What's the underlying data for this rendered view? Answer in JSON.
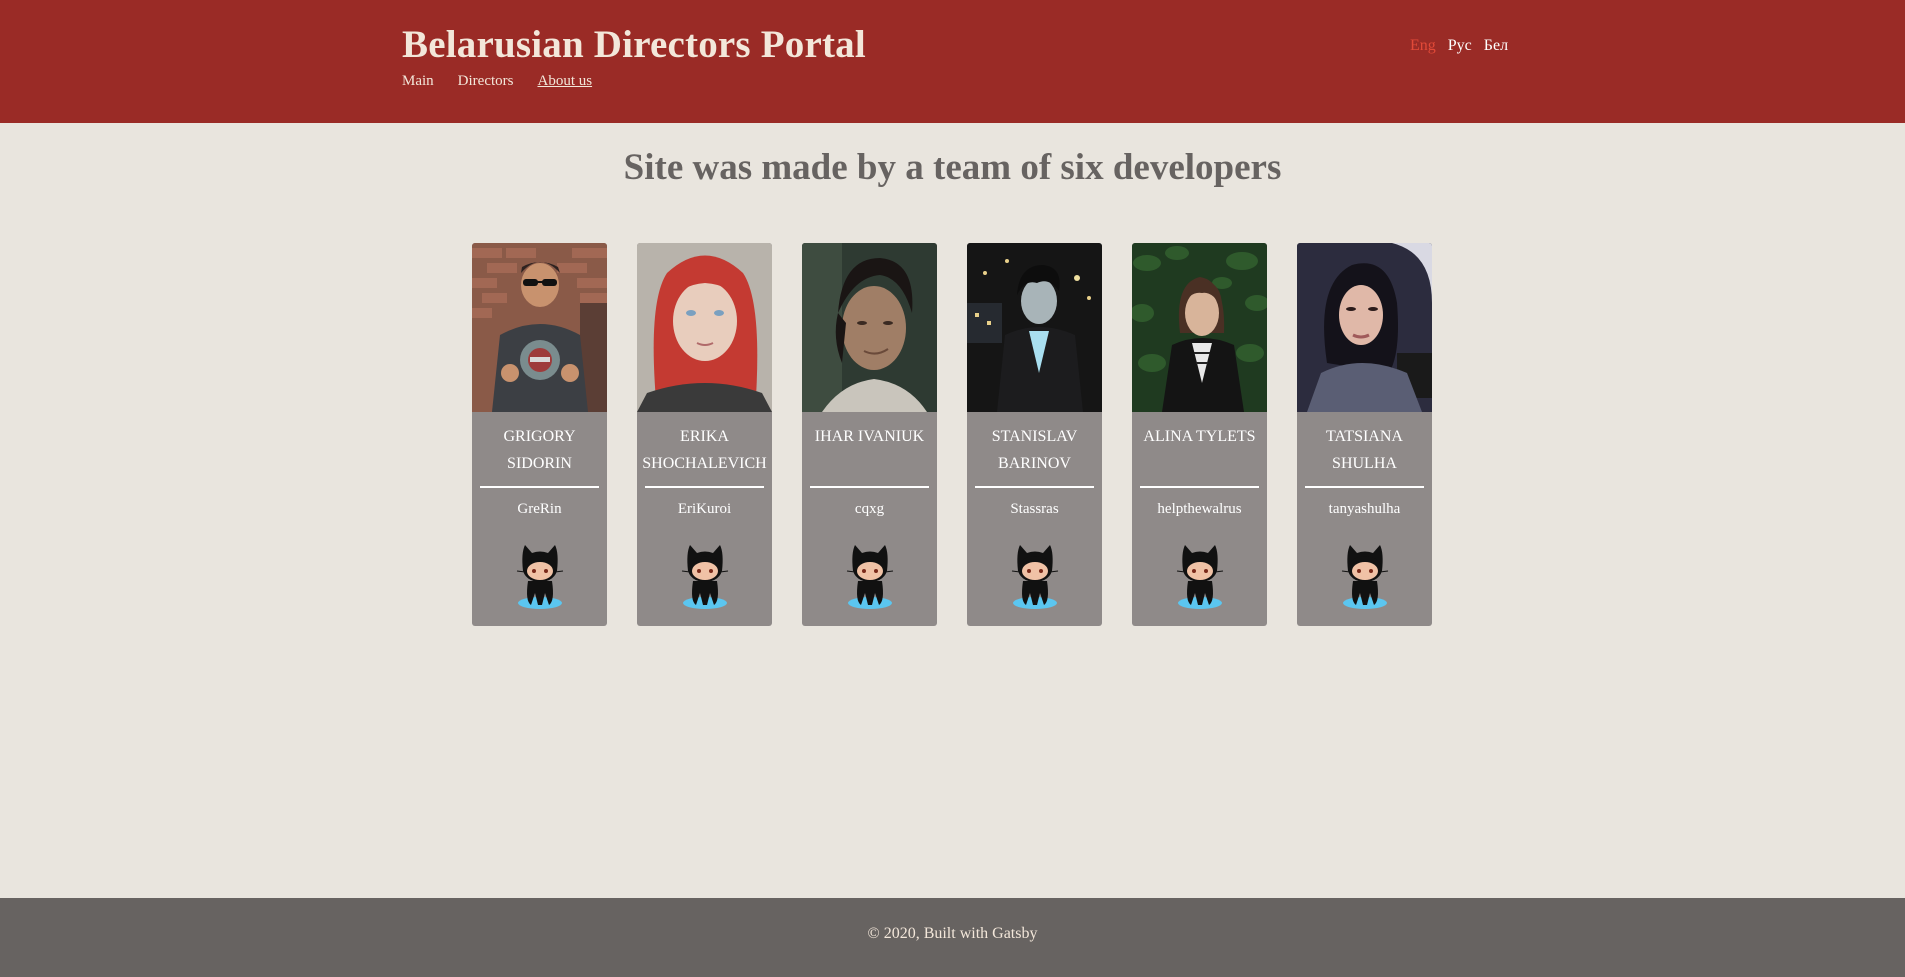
{
  "header": {
    "title": "Belarusian Directors Portal",
    "nav": [
      "Main",
      "Directors",
      "About us"
    ],
    "active_nav": "About us",
    "languages": [
      "Eng",
      "Рус",
      "Бел"
    ],
    "active_language": "Eng"
  },
  "main": {
    "heading": "Site was made by a team of six developers",
    "developers": [
      {
        "name": "GRIGORY SIDORIN",
        "nick": "GreRin"
      },
      {
        "name": "ERIKA SHOCHALEVICH",
        "nick": "EriKuroi"
      },
      {
        "name": "IHAR IVANIUK",
        "nick": "cqxg"
      },
      {
        "name": "STANISLAV BARINOV",
        "nick": "Stassras"
      },
      {
        "name": "ALINA TYLETS",
        "nick": "helpthewalrus"
      },
      {
        "name": "TATSIANA SHULHA",
        "nick": "tanyashulha"
      }
    ]
  },
  "footer": {
    "text": "© 2020, Built with Gatsby"
  },
  "colors": {
    "header_bg": "#9a2b26",
    "page_bg": "#e9e5de",
    "card_bg": "#8f8a89",
    "footer_bg": "#676361",
    "active_lang": "#e24a38"
  },
  "icons": {
    "github": "octocat-icon"
  }
}
